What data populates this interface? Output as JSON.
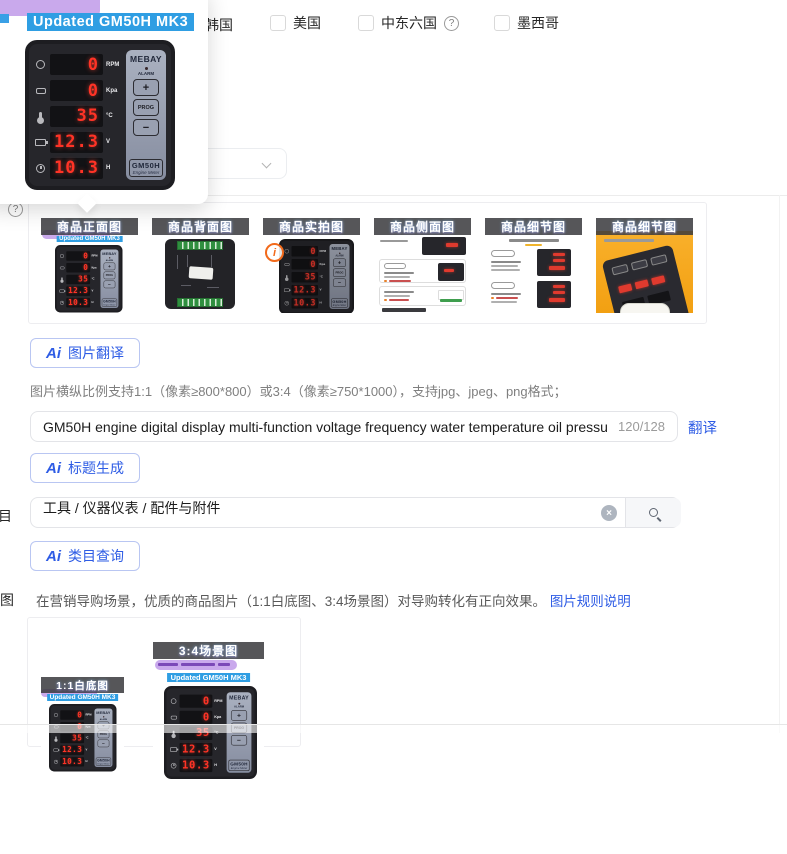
{
  "countries": {
    "items": [
      {
        "label": "韩国"
      },
      {
        "label": "美国"
      },
      {
        "label": "中东六国",
        "help": true
      },
      {
        "label": "墨西哥"
      }
    ]
  },
  "icons": {
    "help_icon": "?",
    "info_icon": "i",
    "clear_icon": "×"
  },
  "preview_popup": {
    "tag": "Updated GM50H MK3"
  },
  "device": {
    "brand": "MEBAY",
    "alarm_label": "ALARM",
    "buttons": {
      "plus": "+",
      "prog": "PROG",
      "minus": "−"
    },
    "model": "GM50H",
    "model_sub": "Engine Meter",
    "rows": [
      {
        "icon": "rpm-gauge-icon",
        "value": "0",
        "unit": "RPM"
      },
      {
        "icon": "oil-pressure-icon",
        "value": "0",
        "unit": "Kpa"
      },
      {
        "icon": "oil-temperature-icon",
        "value": "35",
        "unit": "°C"
      },
      {
        "icon": "battery-icon",
        "value": "12.3",
        "unit": "V"
      },
      {
        "icon": "run-hours-icon",
        "value": "10.3",
        "unit": "H"
      }
    ]
  },
  "images_section": {
    "thumbnails": [
      {
        "label": "商品正面图"
      },
      {
        "label": "商品背面图"
      },
      {
        "label": "商品实拍图"
      },
      {
        "label": "商品侧面图"
      },
      {
        "label": "商品细节图"
      },
      {
        "label": "商品细节图"
      }
    ],
    "ai_label": "Ai",
    "translate_button": "图片翻译",
    "hint": "图片横纵比例支持1:1（像素≥800*800）或3:4（像素≥750*1000），支持jpg、jpeg、png格式；"
  },
  "title_section": {
    "value": "GM50H engine digital display multi-function voltage frequency water temperature oil pressu",
    "counter": "120/128",
    "translate_link": "翻译",
    "ai_label": "Ai",
    "generate_button": "标题生成"
  },
  "category_section": {
    "label": "类目",
    "value": "工具 / 仪器仪表 / 配件与附件",
    "ai_label": "Ai",
    "query_button": "类目查询"
  },
  "guide_section": {
    "label": "导购图",
    "description": "在营销导购场景，优质的商品图片（1:1白底图、3:4场景图）对导购转化有正向效果。",
    "rules_link": "图片规则说明",
    "images": [
      {
        "label": "1:1白底图"
      },
      {
        "label": "3:4场景图"
      }
    ]
  }
}
